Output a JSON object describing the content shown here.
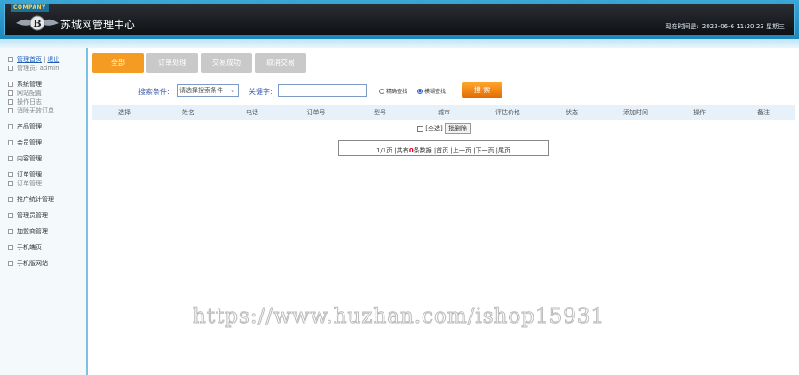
{
  "header": {
    "company": "COMPANY",
    "title": "苏城网管理中心",
    "time_label": "现在时间是:",
    "time_value": "2023-06-6 11:20:23 星期三"
  },
  "sidebar": {
    "home_link": "管理首页",
    "separator": "|",
    "logout_link": "退出",
    "admin": "管理员: admin",
    "groups": [
      {
        "items": [
          "系统管理",
          "网站配置",
          "操作日志",
          "消除无效订单"
        ]
      },
      {
        "items": [
          "产品管理"
        ]
      },
      {
        "items": [
          "会员管理"
        ]
      },
      {
        "items": [
          "内容管理"
        ]
      },
      {
        "items": [
          "订单管理",
          "订单管理"
        ]
      },
      {
        "items": [
          "推广统计管理"
        ]
      },
      {
        "items": [
          "管理员管理"
        ]
      },
      {
        "items": [
          "加盟商管理"
        ]
      },
      {
        "items": [
          "手机端页"
        ]
      },
      {
        "items": [
          "手机版网站"
        ]
      }
    ]
  },
  "tabs": [
    "全部",
    "订单处理",
    "交易成功",
    "取消交易"
  ],
  "search": {
    "condition_label": "搜索条件:",
    "select_value": "请选择搜索条件",
    "keyword_label": "关键字:",
    "exact_label": "精确查找",
    "fuzzy_label": "模糊查找",
    "button": "搜 索"
  },
  "table": {
    "headers": [
      "选择",
      "姓名",
      "电话",
      "订单号",
      "型号",
      "城市",
      "评估价格",
      "状态",
      "添加时间",
      "操作",
      "备注"
    ]
  },
  "batch": {
    "select_all": "[全选]",
    "delete": "批删除"
  },
  "pager": {
    "prefix": "1/1页 |共有",
    "count": "0",
    "suffix": "条数据 |首页 |上一页 |下一页 |尾页"
  },
  "watermark": "https://www.huzhan.com/ishop15931",
  "colors": {
    "header_blue": "#1f86bb",
    "tab_active": "#f59b21",
    "tab_inactive": "#c9c9c9",
    "link_blue": "#1e5bb8"
  }
}
